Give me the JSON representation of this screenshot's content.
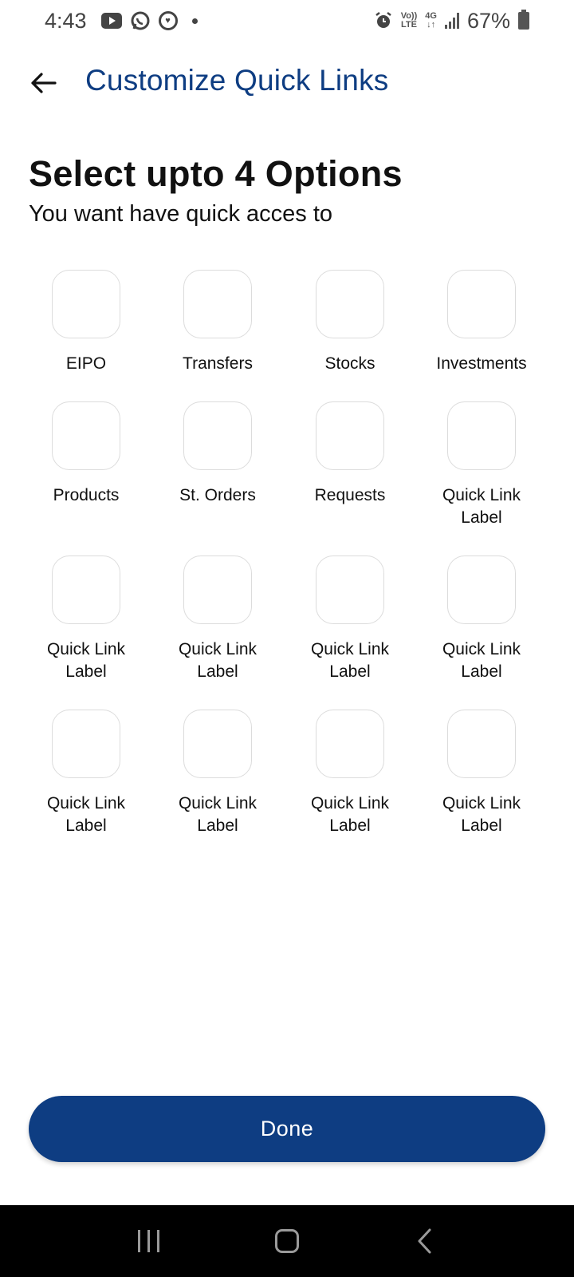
{
  "status_bar": {
    "time": "4:43",
    "battery": "67%",
    "network_top": "Vo))",
    "network_bottom": "LTE",
    "gen": "4G",
    "icons": [
      "youtube-icon",
      "whatsapp-icon",
      "app-notification-icon",
      "dot-icon",
      "alarm-icon",
      "volte-icon",
      "4g-icon",
      "signal-icon",
      "battery-icon"
    ]
  },
  "app_bar": {
    "back_icon": "arrow-left-icon",
    "title": "Customize Quick Links"
  },
  "content": {
    "heading": "Select upto 4 Options",
    "subheading": "You want have quick acces to"
  },
  "tiles": [
    {
      "label": "EIPO"
    },
    {
      "label": "Transfers"
    },
    {
      "label": "Stocks"
    },
    {
      "label": "Investments"
    },
    {
      "label": "Products"
    },
    {
      "label": "St. Orders"
    },
    {
      "label": "Requests"
    },
    {
      "label": "Quick Link Label"
    },
    {
      "label": "Quick Link Label"
    },
    {
      "label": "Quick Link Label"
    },
    {
      "label": "Quick Link Label"
    },
    {
      "label": "Quick Link Label"
    },
    {
      "label": "Quick Link Label"
    },
    {
      "label": "Quick Link Label"
    },
    {
      "label": "Quick Link Label"
    },
    {
      "label": "Quick Link Label"
    }
  ],
  "done_label": "Done",
  "nav_bar": {
    "icons": [
      "recent-apps-icon",
      "home-icon",
      "back-icon"
    ]
  },
  "colors": {
    "primary": "#0e3d82",
    "tile_border": "#dcdcdc",
    "nav_bg": "#000000"
  }
}
